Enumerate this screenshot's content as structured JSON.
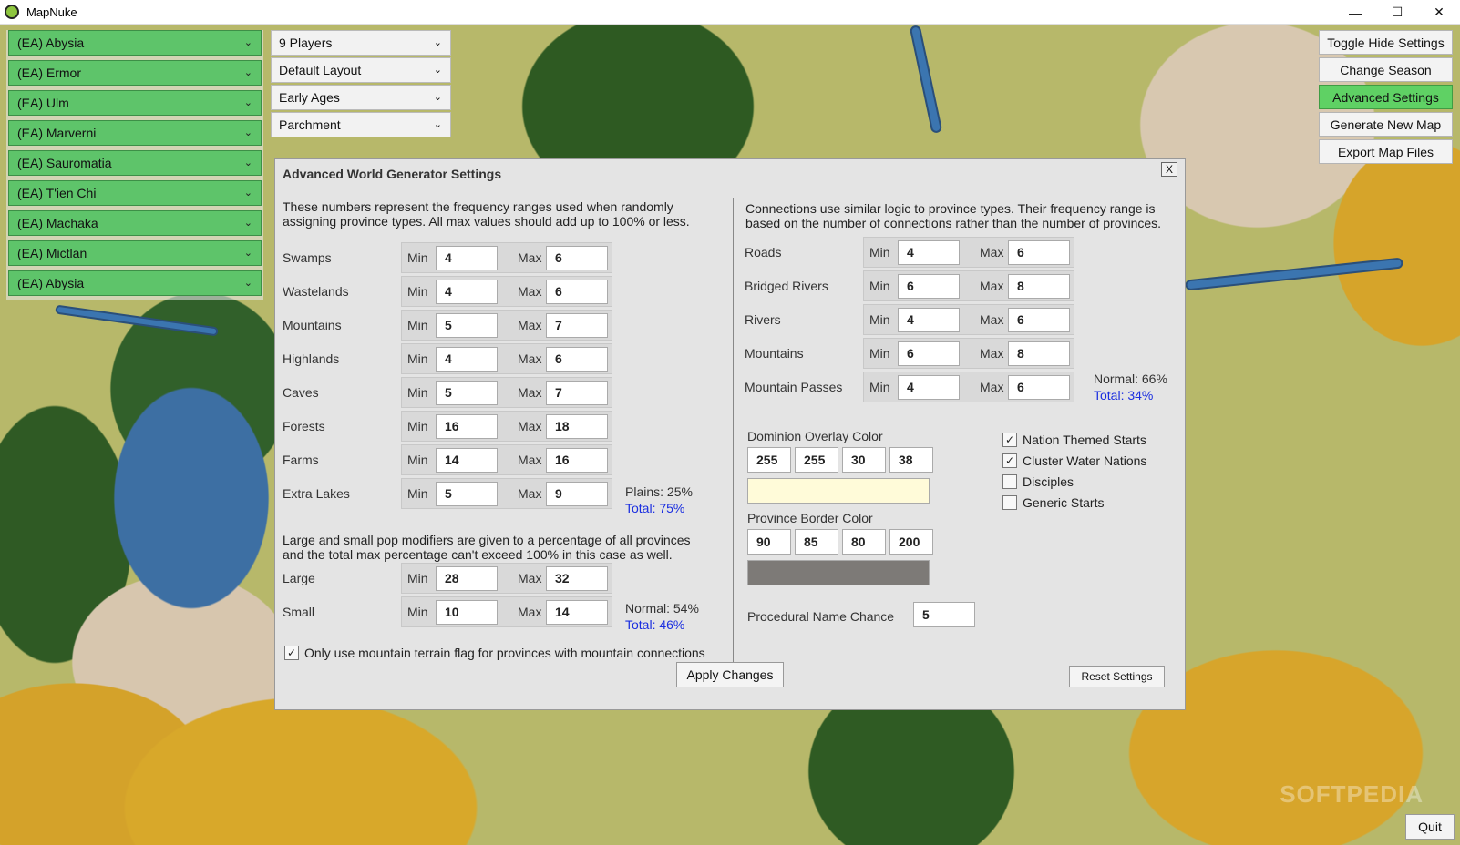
{
  "window": {
    "title": "MapNuke",
    "minimize": "—",
    "maximize": "☐",
    "close": "✕"
  },
  "nations": [
    "(EA) Abysia",
    "(EA) Ermor",
    "(EA) Ulm",
    "(EA) Marverni",
    "(EA) Sauromatia",
    "(EA) T'ien Chi",
    "(EA) Machaka",
    "(EA) Mictlan",
    "(EA) Abysia"
  ],
  "dropdowns": {
    "players": "9 Players",
    "layout": "Default Layout",
    "age": "Early Ages",
    "style": "Parchment"
  },
  "side_buttons": {
    "toggle": "Toggle Hide Settings",
    "season": "Change Season",
    "advanced": "Advanced Settings",
    "generate": "Generate New Map",
    "export": "Export Map Files"
  },
  "dialog": {
    "title": "Advanced World Generator Settings",
    "close": "X",
    "min_label": "Min",
    "max_label": "Max",
    "province_desc_1": "These numbers represent the frequency ranges used when randomly",
    "province_desc_2": "assigning province types. All max values should add up to 100% or less.",
    "provinces": [
      {
        "label": "Swamps",
        "min": "4",
        "max": "6"
      },
      {
        "label": "Wastelands",
        "min": "4",
        "max": "6"
      },
      {
        "label": "Mountains",
        "min": "5",
        "max": "7"
      },
      {
        "label": "Highlands",
        "min": "4",
        "max": "6"
      },
      {
        "label": "Caves",
        "min": "5",
        "max": "7"
      },
      {
        "label": "Forests",
        "min": "16",
        "max": "18"
      },
      {
        "label": "Farms",
        "min": "14",
        "max": "16"
      },
      {
        "label": "Extra Lakes",
        "min": "5",
        "max": "9"
      }
    ],
    "plains_stat": "Plains: 25%",
    "plains_total": "Total: 75%",
    "pop_desc_1": "Large and small pop modifiers are given to a percentage of all provinces",
    "pop_desc_2": "and the total max percentage can't exceed 100% in this case as well.",
    "pop": [
      {
        "label": "Large",
        "min": "28",
        "max": "32"
      },
      {
        "label": "Small",
        "min": "10",
        "max": "14"
      }
    ],
    "pop_stat": "Normal: 54%",
    "pop_total": "Total: 46%",
    "mountain_flag_label": "Only use mountain terrain flag for provinces with mountain connections",
    "mountain_flag_checked": true,
    "conn_desc_1": "Connections use similar logic to province types. Their frequency range is",
    "conn_desc_2": "based on the number of connections rather than the number of provinces.",
    "connections": [
      {
        "label": "Roads",
        "min": "4",
        "max": "6"
      },
      {
        "label": "Bridged Rivers",
        "min": "6",
        "max": "8"
      },
      {
        "label": "Rivers",
        "min": "4",
        "max": "6"
      },
      {
        "label": "Mountains",
        "min": "6",
        "max": "8"
      },
      {
        "label": "Mountain Passes",
        "min": "4",
        "max": "6"
      }
    ],
    "conn_stat": "Normal: 66%",
    "conn_total": "Total: 34%",
    "dominion_label": "Dominion Overlay Color",
    "dominion_values": [
      "255",
      "255",
      "30",
      "38"
    ],
    "dominion_swatch": "#fffbd9",
    "border_label": "Province Border Color",
    "border_values": [
      "90",
      "85",
      "80",
      "200"
    ],
    "border_swatch": "#7d7a77",
    "options": [
      {
        "label": "Nation Themed Starts",
        "checked": true
      },
      {
        "label": "Cluster Water Nations",
        "checked": true
      },
      {
        "label": "Disciples",
        "checked": false
      },
      {
        "label": "Generic Starts",
        "checked": false
      }
    ],
    "name_chance_label": "Procedural Name Chance",
    "name_chance_value": "5",
    "apply": "Apply Changes",
    "reset": "Reset Settings"
  },
  "quit": "Quit",
  "watermark": "SOFTPEDIA",
  "colors": {
    "nation_green": "#5ec46a",
    "active_button": "#5fd164",
    "total_blue": "#1a2ee0"
  }
}
